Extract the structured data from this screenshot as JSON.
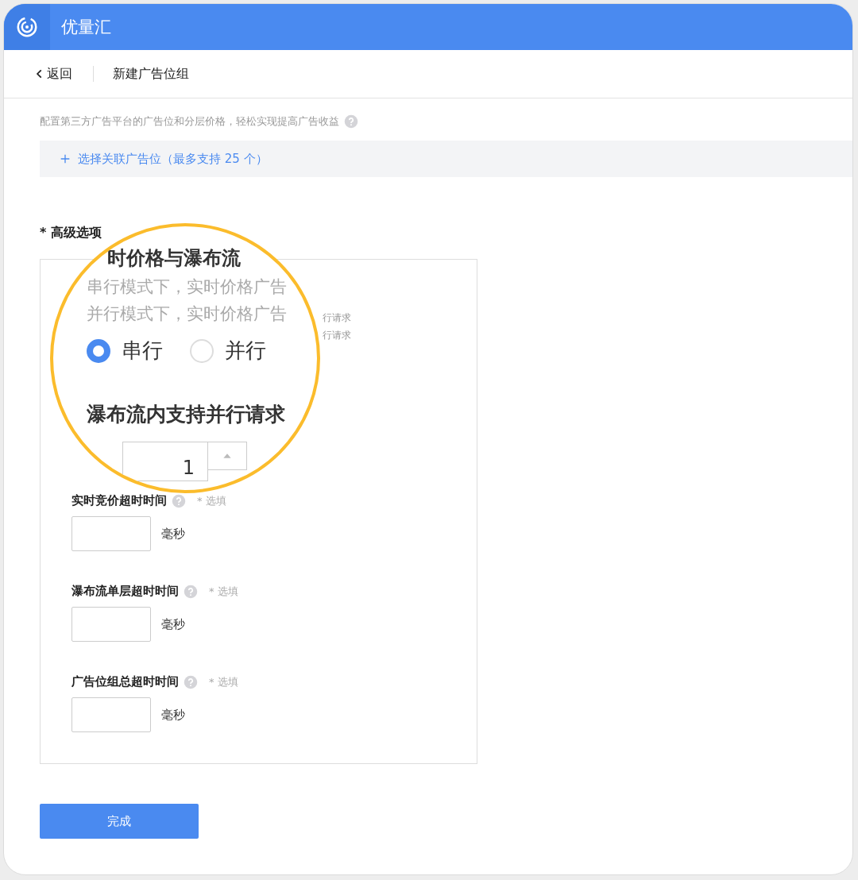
{
  "app": {
    "title": "优量汇"
  },
  "nav": {
    "back": "返回",
    "page_title": "新建广告位组"
  },
  "section": {
    "description": "配置第三方广告平台的广告位和分层价格，轻松实现提高广告收益",
    "add_button": "选择关联广告位（最多支持 25 个）"
  },
  "advanced": {
    "label": "* 高级选项",
    "notes": [
      "行请求",
      "行请求"
    ],
    "fields": [
      {
        "label": "实时竞价超时时间",
        "hint": "* 选填",
        "unit": "毫秒"
      },
      {
        "label": "瀑布流单层超时时间",
        "hint": "* 选填",
        "unit": "毫秒"
      },
      {
        "label": "广告位组总超时时间",
        "hint": "* 选填",
        "unit": "毫秒"
      }
    ]
  },
  "magnifier": {
    "heading": "时价格与瀑布流",
    "lines": [
      "串行模式下，实时价格广告",
      "并行模式下，实时价格广告"
    ],
    "options": [
      {
        "label": "串行",
        "selected": true
      },
      {
        "label": "并行",
        "selected": false
      }
    ],
    "subheading": "瀑布流内支持并行请求",
    "stepper_value": "1"
  },
  "submit": "完成"
}
